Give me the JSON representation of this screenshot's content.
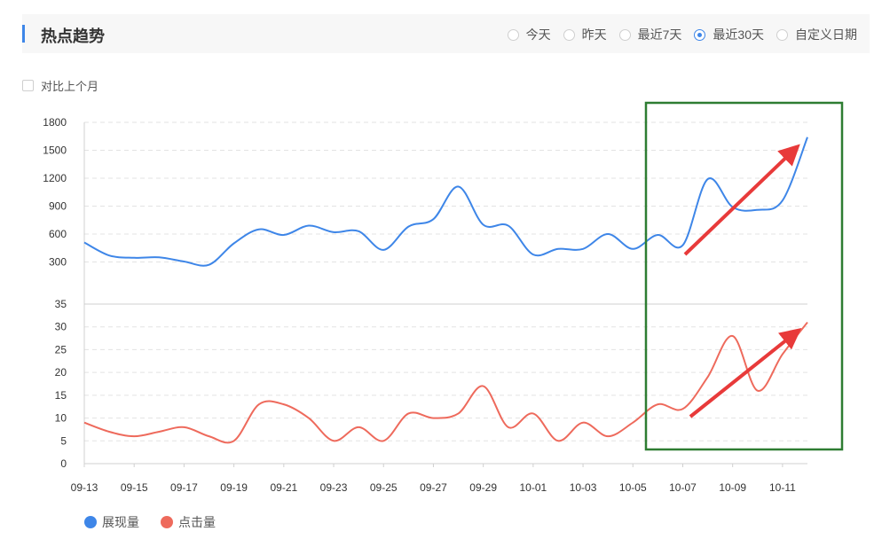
{
  "header": {
    "title": "热点趋势"
  },
  "date_ranges": [
    {
      "label": "今天",
      "selected": false
    },
    {
      "label": "昨天",
      "selected": false
    },
    {
      "label": "最近7天",
      "selected": false
    },
    {
      "label": "最近30天",
      "selected": true
    },
    {
      "label": "自定义日期",
      "selected": false
    }
  ],
  "compare": {
    "label": "对比上个月",
    "checked": false
  },
  "colors": {
    "impressions": "#3e86e8",
    "clicks": "#ee6a5c",
    "highlight_box": "#2e7d32",
    "arrow": "#e83a3a"
  },
  "chart_data": [
    {
      "type": "line",
      "name": "impressions_panel",
      "x": [
        "09-13",
        "09-14",
        "09-15",
        "09-16",
        "09-17",
        "09-18",
        "09-19",
        "09-20",
        "09-21",
        "09-22",
        "09-23",
        "09-24",
        "09-25",
        "09-26",
        "09-27",
        "09-28",
        "09-29",
        "09-30",
        "10-01",
        "10-02",
        "10-03",
        "10-04",
        "10-05",
        "10-06",
        "10-07",
        "10-08",
        "10-09",
        "10-10",
        "10-11",
        "10-12"
      ],
      "series": [
        {
          "name": "展现量",
          "values": [
            510,
            370,
            345,
            350,
            305,
            270,
            500,
            650,
            590,
            690,
            620,
            630,
            430,
            680,
            760,
            1110,
            700,
            690,
            380,
            440,
            440,
            600,
            440,
            590,
            480,
            1190,
            890,
            860,
            960,
            1640
          ]
        }
      ],
      "yticks": [
        300,
        600,
        900,
        1200,
        1500,
        1800
      ],
      "ylim": [
        0,
        1800
      ]
    },
    {
      "type": "line",
      "name": "clicks_panel",
      "x": [
        "09-13",
        "09-14",
        "09-15",
        "09-16",
        "09-17",
        "09-18",
        "09-19",
        "09-20",
        "09-21",
        "09-22",
        "09-23",
        "09-24",
        "09-25",
        "09-26",
        "09-27",
        "09-28",
        "09-29",
        "09-30",
        "10-01",
        "10-02",
        "10-03",
        "10-04",
        "10-05",
        "10-06",
        "10-07",
        "10-08",
        "10-09",
        "10-10",
        "10-11",
        "10-12"
      ],
      "series": [
        {
          "name": "点击量",
          "values": [
            9,
            7,
            6,
            7,
            8,
            6,
            5,
            13,
            13,
            10,
            5,
            8,
            5,
            11,
            10,
            11,
            17,
            8,
            11,
            5,
            9,
            6,
            9,
            13,
            12,
            19,
            28,
            16,
            24,
            31
          ]
        }
      ],
      "yticks": [
        0,
        5,
        10,
        15,
        20,
        25,
        30,
        35
      ],
      "ylim": [
        0,
        35
      ]
    }
  ],
  "x_tick_labels": [
    "09-13",
    "09-15",
    "09-17",
    "09-19",
    "09-21",
    "09-23",
    "09-25",
    "09-27",
    "09-29",
    "10-01",
    "10-03",
    "10-05",
    "10-07",
    "10-09",
    "10-11"
  ],
  "legend": [
    {
      "label": "展现量",
      "color": "#3e86e8"
    },
    {
      "label": "点击量",
      "color": "#ee6a5c"
    }
  ]
}
